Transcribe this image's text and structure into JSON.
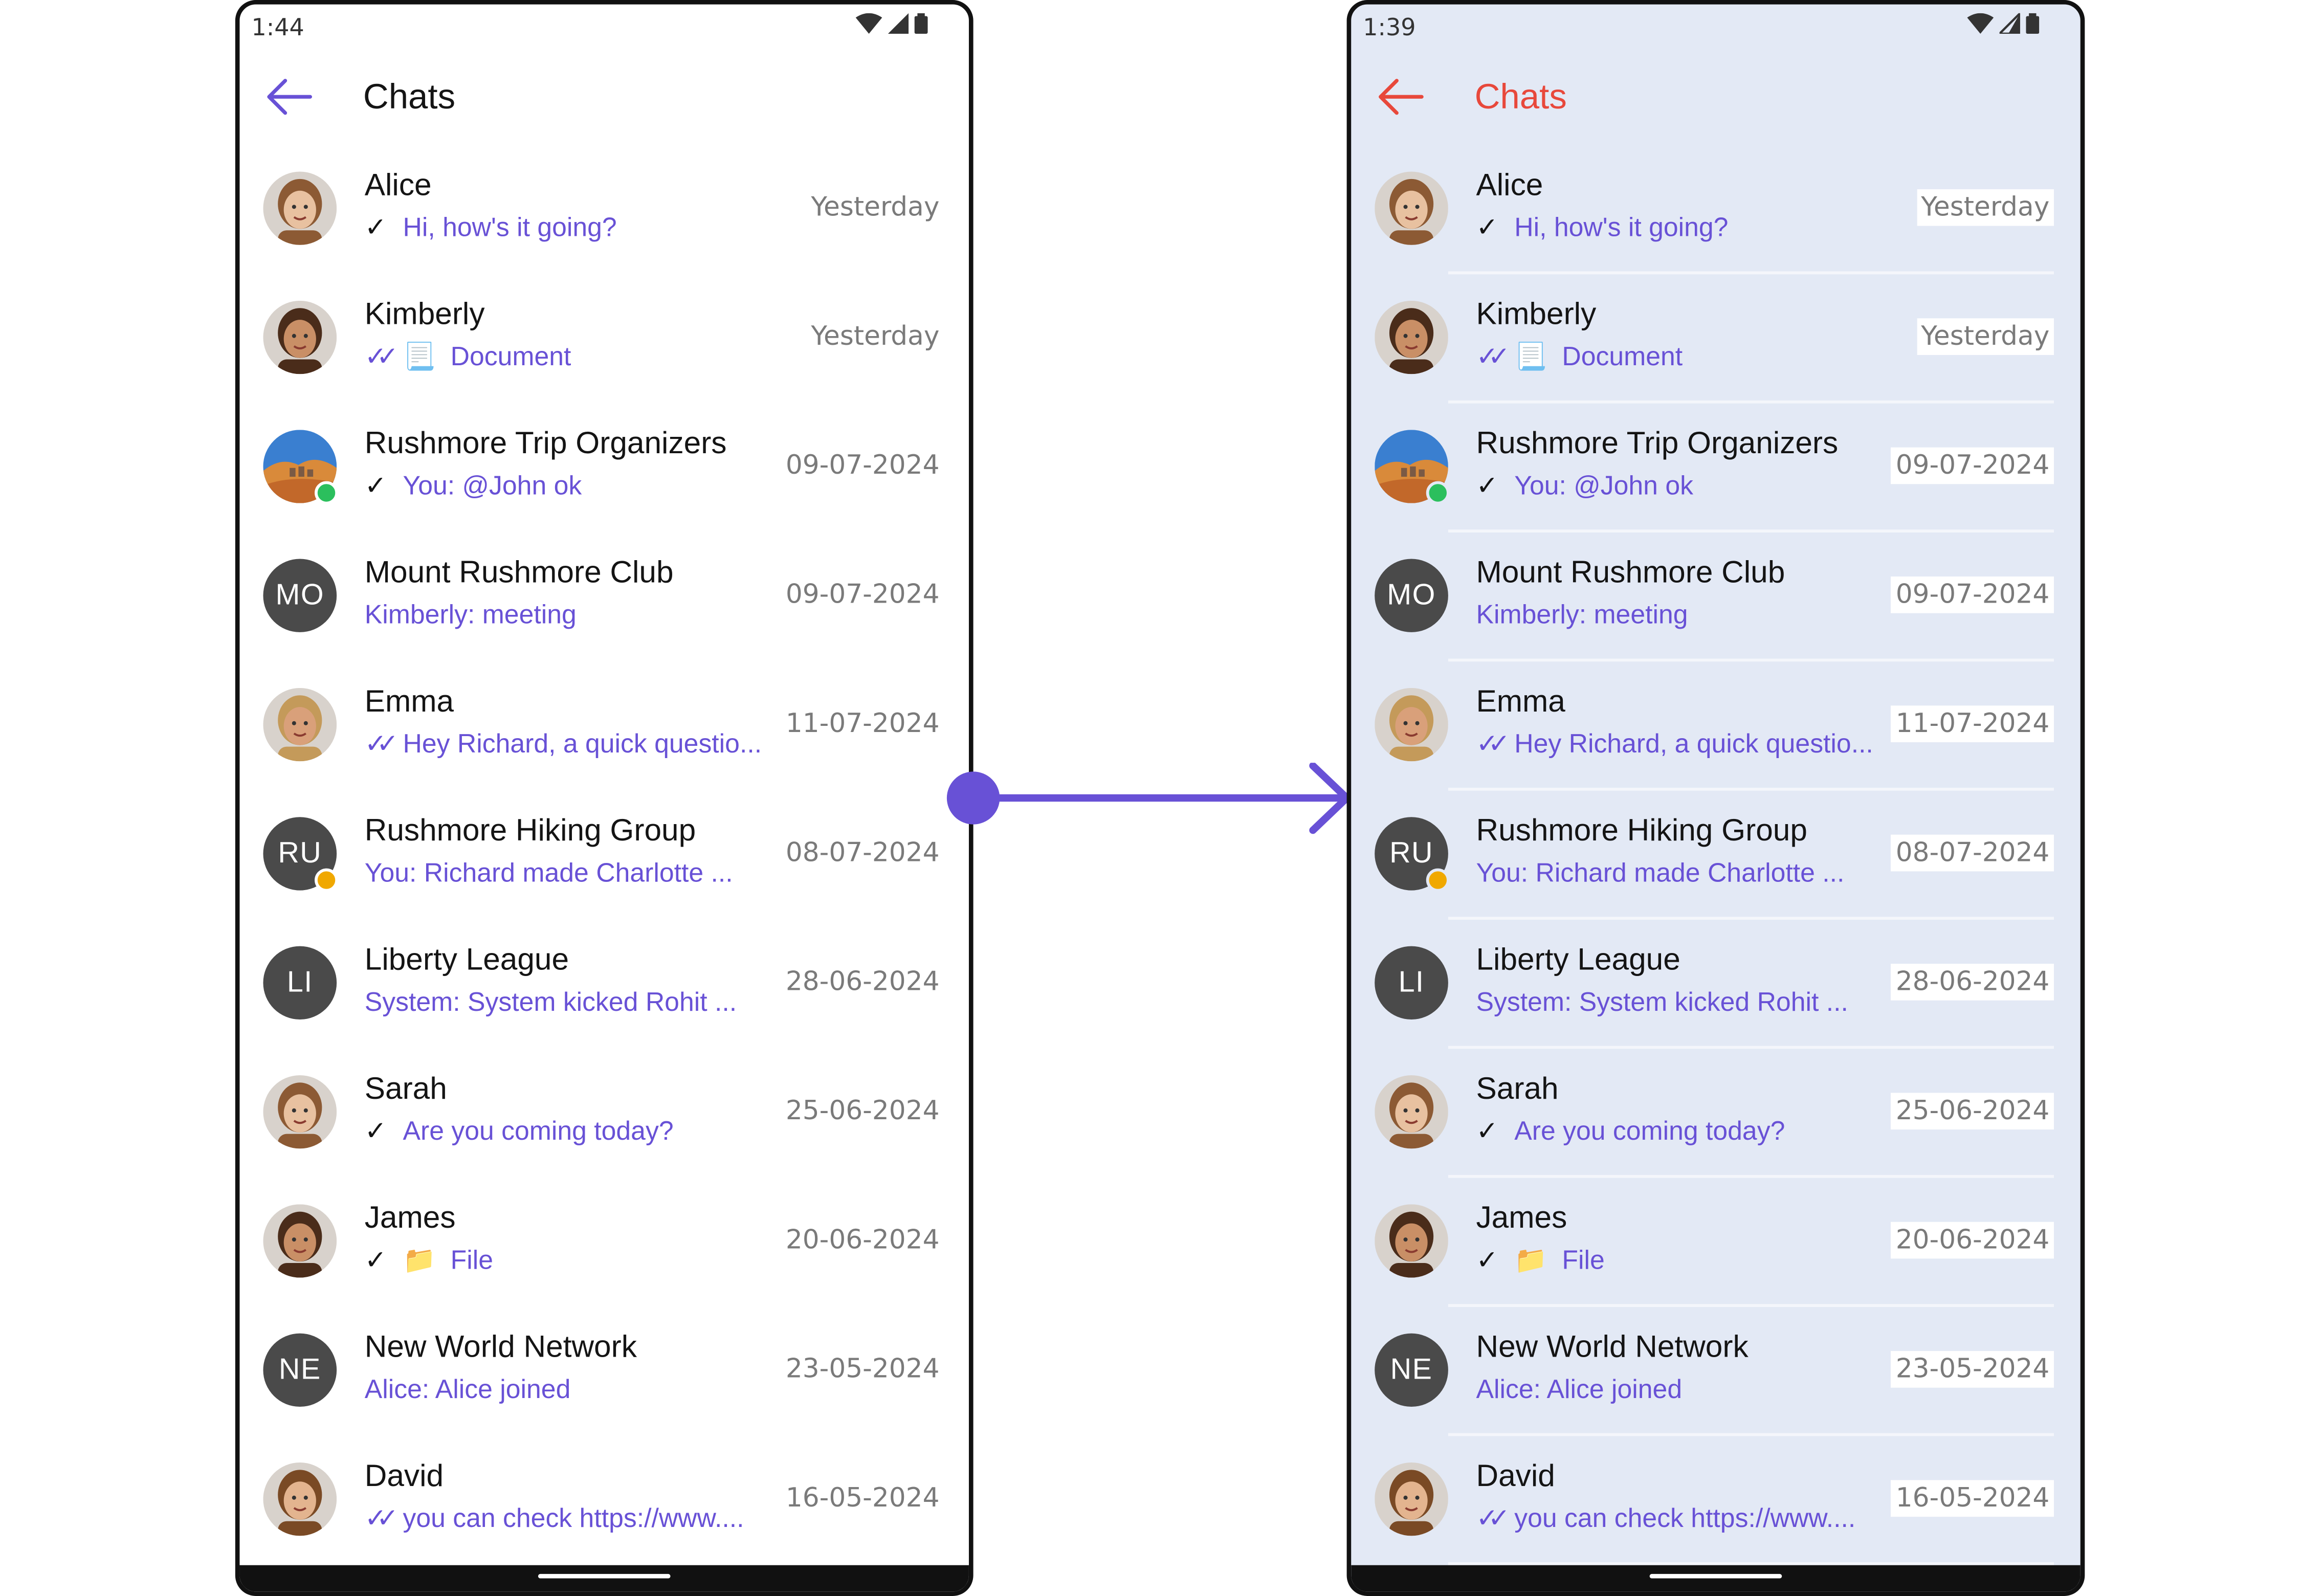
{
  "colors": {
    "accent": "#6851d6",
    "left_bg": "#ffffff",
    "right_bg": "#e3e9f5",
    "right_title": "#e8483b",
    "avatar_initials_bg": "#4a4a4a",
    "online_badge": "#2bbf5d",
    "locked_badge": "#f0a800"
  },
  "left": {
    "status_time": "1:44",
    "title": "Chats"
  },
  "right": {
    "status_time": "1:39",
    "title": "Chats"
  },
  "chats": [
    {
      "name": "Alice",
      "receipt": "sent",
      "icon": "",
      "preview": "Hi, how's it going?",
      "date": "Yesterday",
      "avatar": "photo",
      "initials": "",
      "badge": ""
    },
    {
      "name": "Kimberly",
      "receipt": "read",
      "icon": "📃",
      "preview": "Document",
      "date": "Yesterday",
      "avatar": "photo",
      "initials": "",
      "badge": ""
    },
    {
      "name": "Rushmore Trip Organizers",
      "receipt": "sent",
      "icon": "",
      "preview": "You: @John ok",
      "date": "09-07-2024",
      "avatar": "landscape",
      "initials": "",
      "badge": "online"
    },
    {
      "name": "Mount Rushmore Club",
      "receipt": "",
      "icon": "",
      "preview": "Kimberly: meeting",
      "date": "09-07-2024",
      "avatar": "initials",
      "initials": "MO",
      "badge": ""
    },
    {
      "name": "Emma",
      "receipt": "read",
      "icon": "",
      "preview": "Hey Richard, a quick questio...",
      "date": "11-07-2024",
      "avatar": "photo",
      "initials": "",
      "badge": ""
    },
    {
      "name": "Rushmore Hiking Group",
      "receipt": "",
      "icon": "",
      "preview": "You: Richard made Charlotte ...",
      "date": "08-07-2024",
      "avatar": "initials",
      "initials": "RU",
      "badge": "locked"
    },
    {
      "name": "Liberty League",
      "receipt": "",
      "icon": "",
      "preview": "System: System kicked Rohit ...",
      "date": "28-06-2024",
      "avatar": "initials",
      "initials": "LI",
      "badge": ""
    },
    {
      "name": "Sarah",
      "receipt": "sent",
      "icon": "",
      "preview": "Are you coming today?",
      "date": "25-06-2024",
      "avatar": "photo",
      "initials": "",
      "badge": ""
    },
    {
      "name": "James",
      "receipt": "sent",
      "icon": "📁",
      "preview": "File",
      "date": "20-06-2024",
      "avatar": "photo",
      "initials": "",
      "badge": ""
    },
    {
      "name": "New World Network",
      "receipt": "",
      "icon": "",
      "preview": "Alice: Alice joined",
      "date": "23-05-2024",
      "avatar": "initials",
      "initials": "NE",
      "badge": ""
    },
    {
      "name": "David",
      "receipt": "read",
      "icon": "",
      "preview": "you can check https://www....",
      "date": "16-05-2024",
      "avatar": "photo",
      "initials": "",
      "badge": ""
    }
  ]
}
